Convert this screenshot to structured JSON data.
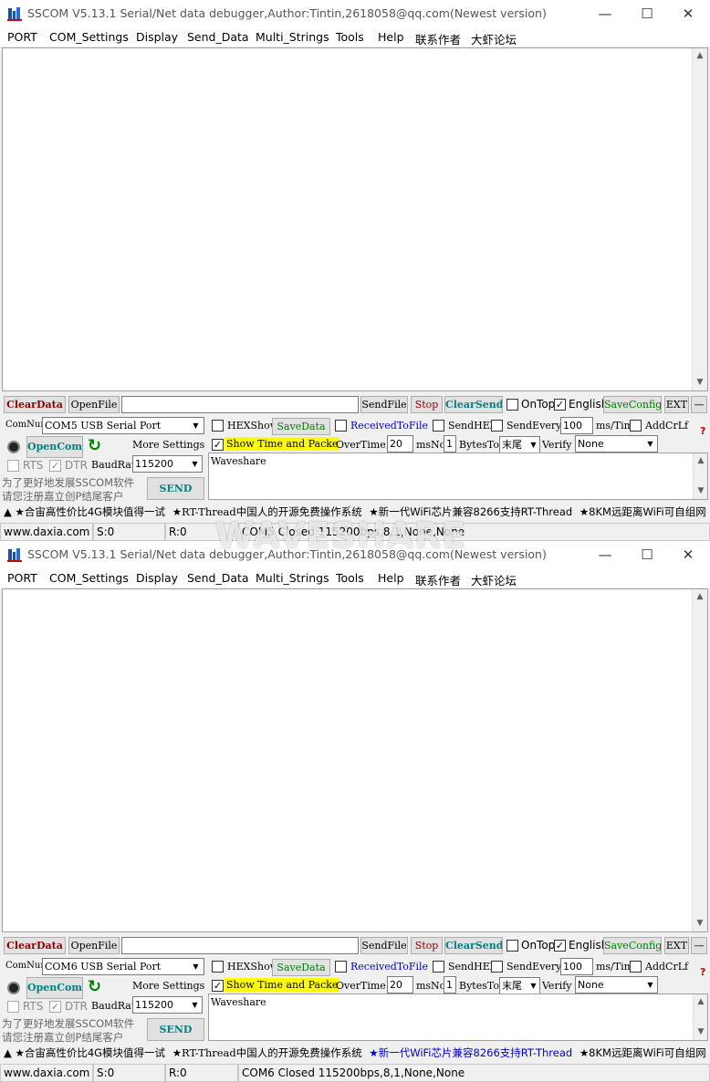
{
  "app": {
    "title": "SSCOM V5.13.1 Serial/Net data debugger,Author:Tintin,2618058@qq.com(Newest version)",
    "menu": [
      "PORT",
      "COM_Settings",
      "Display",
      "Send_Data",
      "Multi_Strings",
      "Tools",
      "Help",
      "联系作者",
      "大虾论坛"
    ],
    "window_buttons": {
      "minimize": "—",
      "maximize": "☐",
      "close": "✕"
    }
  },
  "toolbar": {
    "clear_data": "ClearData",
    "open_file": "OpenFile",
    "send_file": "SendFile",
    "stop": "Stop",
    "clear_send": "ClearSend",
    "on_top": "OnTop",
    "english": "English",
    "save_config": "SaveConfig",
    "ext": "EXT",
    "collapse": "—"
  },
  "settings": {
    "comnum_label": "ComNum",
    "baud_label": "BaudRat",
    "baud_value": "115200",
    "open_com": "OpenCom",
    "more_settings": "More Settings",
    "rts": "RTS",
    "dtr": "DTR",
    "hex_show": "HEXShow",
    "save_data": "SaveData",
    "received_to_file": "ReceivedToFile",
    "send_hex": "SendHEX",
    "send_every": "SendEvery:",
    "send_every_value": "100",
    "ms_tim": "ms/Tim",
    "add_crlf": "AddCrLf",
    "show_time": "Show Time and Packe",
    "overtime": "OverTime:",
    "overtime_value": "20",
    "ms": "ms",
    "no": "No",
    "no_value": "1",
    "bytes_to": "BytesTo",
    "bytes_to_value": "末尾",
    "verify": "Verify",
    "verify_value": "None",
    "send": "SEND",
    "note_line1": "为了更好地发展SSCOM软件",
    "note_line2": "请您注册嘉立创P结尾客户",
    "help_mark": "?"
  },
  "ticker": {
    "lead": "▲",
    "items": [
      "★合宙高性价比4G模块值得一试",
      "★RT-Thread中国人的开源免费操作系统",
      "★新一代WiFi芯片兼容8266支持RT-Thread",
      "★8KM远距离WiFi可自组网"
    ]
  },
  "status": {
    "website": "www.daxia.com",
    "sent": "S:0",
    "received": "R:0"
  },
  "windows": [
    {
      "com_port": "COM5 USB Serial Port",
      "send_text": "Waveshare",
      "port_status": "COM5 Closed  115200bps,8,1,None,None"
    },
    {
      "com_port": "COM6 USB Serial Port",
      "send_text": "Waveshare",
      "port_status": "COM6 Closed  115200bps,8,1,None,None"
    }
  ],
  "watermark": "WAVESHARE",
  "colors": {
    "clear_red": "#8b0000",
    "teal": "#008080",
    "highlight": "#ffff00",
    "ticker_link": "#0000cc",
    "open_green": "#008000"
  }
}
